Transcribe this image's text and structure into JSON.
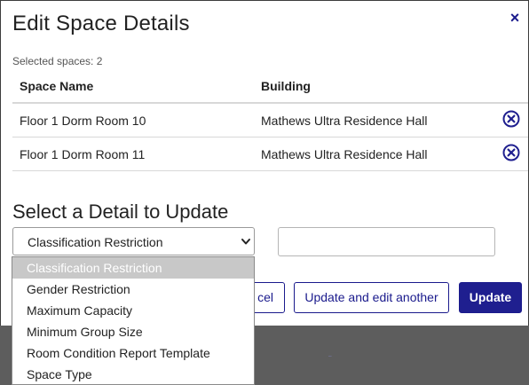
{
  "modal": {
    "title": "Edit Space Details",
    "close_glyph": "×",
    "selected_count": "Selected spaces: 2"
  },
  "table": {
    "headers": [
      "Space Name",
      "Building"
    ],
    "rows": [
      {
        "space_name": "Floor 1 Dorm Room 10",
        "building": "Mathews Ultra Residence Hall",
        "remove_icon": "remove-circle-icon"
      },
      {
        "space_name": "Floor 1 Dorm Room 11",
        "building": "Mathews Ultra Residence Hall",
        "remove_icon": "remove-circle-icon"
      }
    ]
  },
  "detail": {
    "section_title": "Select a Detail to Update",
    "selected_option": "Classification Restriction",
    "value_input": {
      "value": "",
      "placeholder": ""
    },
    "options": [
      "Classification Restriction",
      "Gender Restriction",
      "Maximum Capacity",
      "Minimum Group Size",
      "Room Condition Report Template",
      "Space Type"
    ]
  },
  "buttons": {
    "cancel_partial": "cel",
    "update_and_edit_another": "Update and edit another",
    "update": "Update"
  },
  "colors": {
    "accent": "#1f1f8f",
    "backdrop": "#5d5d5d",
    "dropdown_highlight": "#c8c8c8"
  }
}
